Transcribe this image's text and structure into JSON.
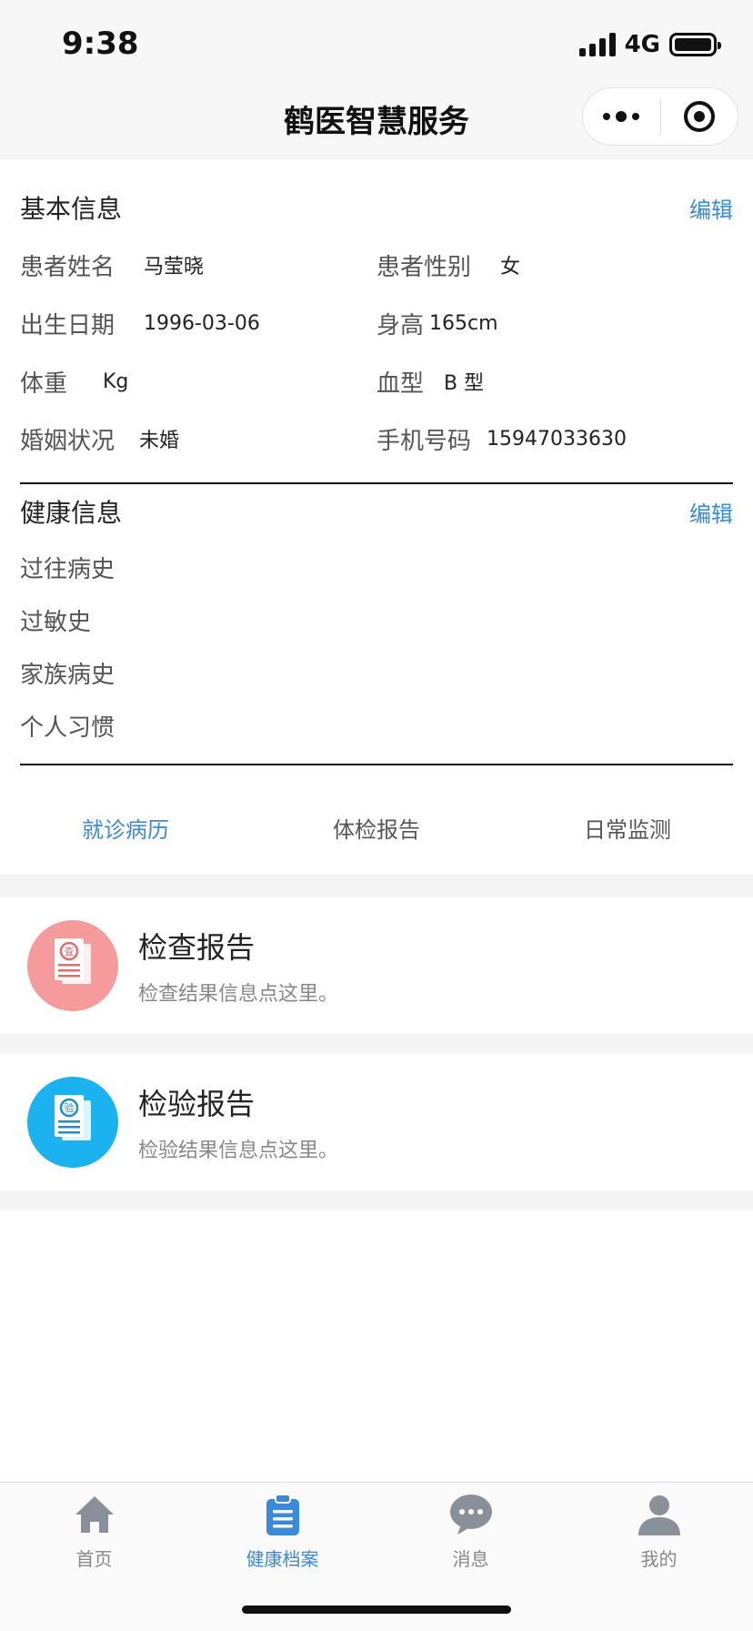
{
  "status": {
    "time": "9:38",
    "network": "4G"
  },
  "nav": {
    "title": "鹤医智慧服务"
  },
  "basic_info": {
    "title": "基本信息",
    "edit": "编辑",
    "fields": [
      {
        "label": "患者姓名",
        "value": "马莹晓"
      },
      {
        "label": "患者性别",
        "value": "女"
      },
      {
        "label": "出生日期",
        "value": "1996-03-06"
      },
      {
        "label": "身高",
        "value": "165cm"
      },
      {
        "label": "体重",
        "value": "Kg"
      },
      {
        "label": "血型",
        "value": "B 型"
      },
      {
        "label": "婚姻状况",
        "value": "未婚"
      },
      {
        "label": "手机号码",
        "value": "15947033630"
      }
    ]
  },
  "health_info": {
    "title": "健康信息",
    "edit": "编辑",
    "items": [
      "过往病史",
      "过敏史",
      "家族病史",
      "个人习惯"
    ]
  },
  "tabs": [
    {
      "label": "就诊病历",
      "active": true
    },
    {
      "label": "体检报告",
      "active": false
    },
    {
      "label": "日常监测",
      "active": false
    }
  ],
  "cards": [
    {
      "title": "检查报告",
      "subtitle": "检查结果信息点这里。",
      "badge": "查",
      "color": "#f59b9b"
    },
    {
      "title": "检验报告",
      "subtitle": "检验结果信息点这里。",
      "badge": "验",
      "color": "#1ab3f0"
    }
  ],
  "tabbar": [
    {
      "label": "首页",
      "icon": "home-icon"
    },
    {
      "label": "健康档案",
      "icon": "clipboard-icon",
      "active": true
    },
    {
      "label": "消息",
      "icon": "chat-bubble-icon"
    },
    {
      "label": "我的",
      "icon": "user-icon"
    }
  ],
  "colors": {
    "accent": "#3b8ad9",
    "inactive": "#8a9099"
  }
}
